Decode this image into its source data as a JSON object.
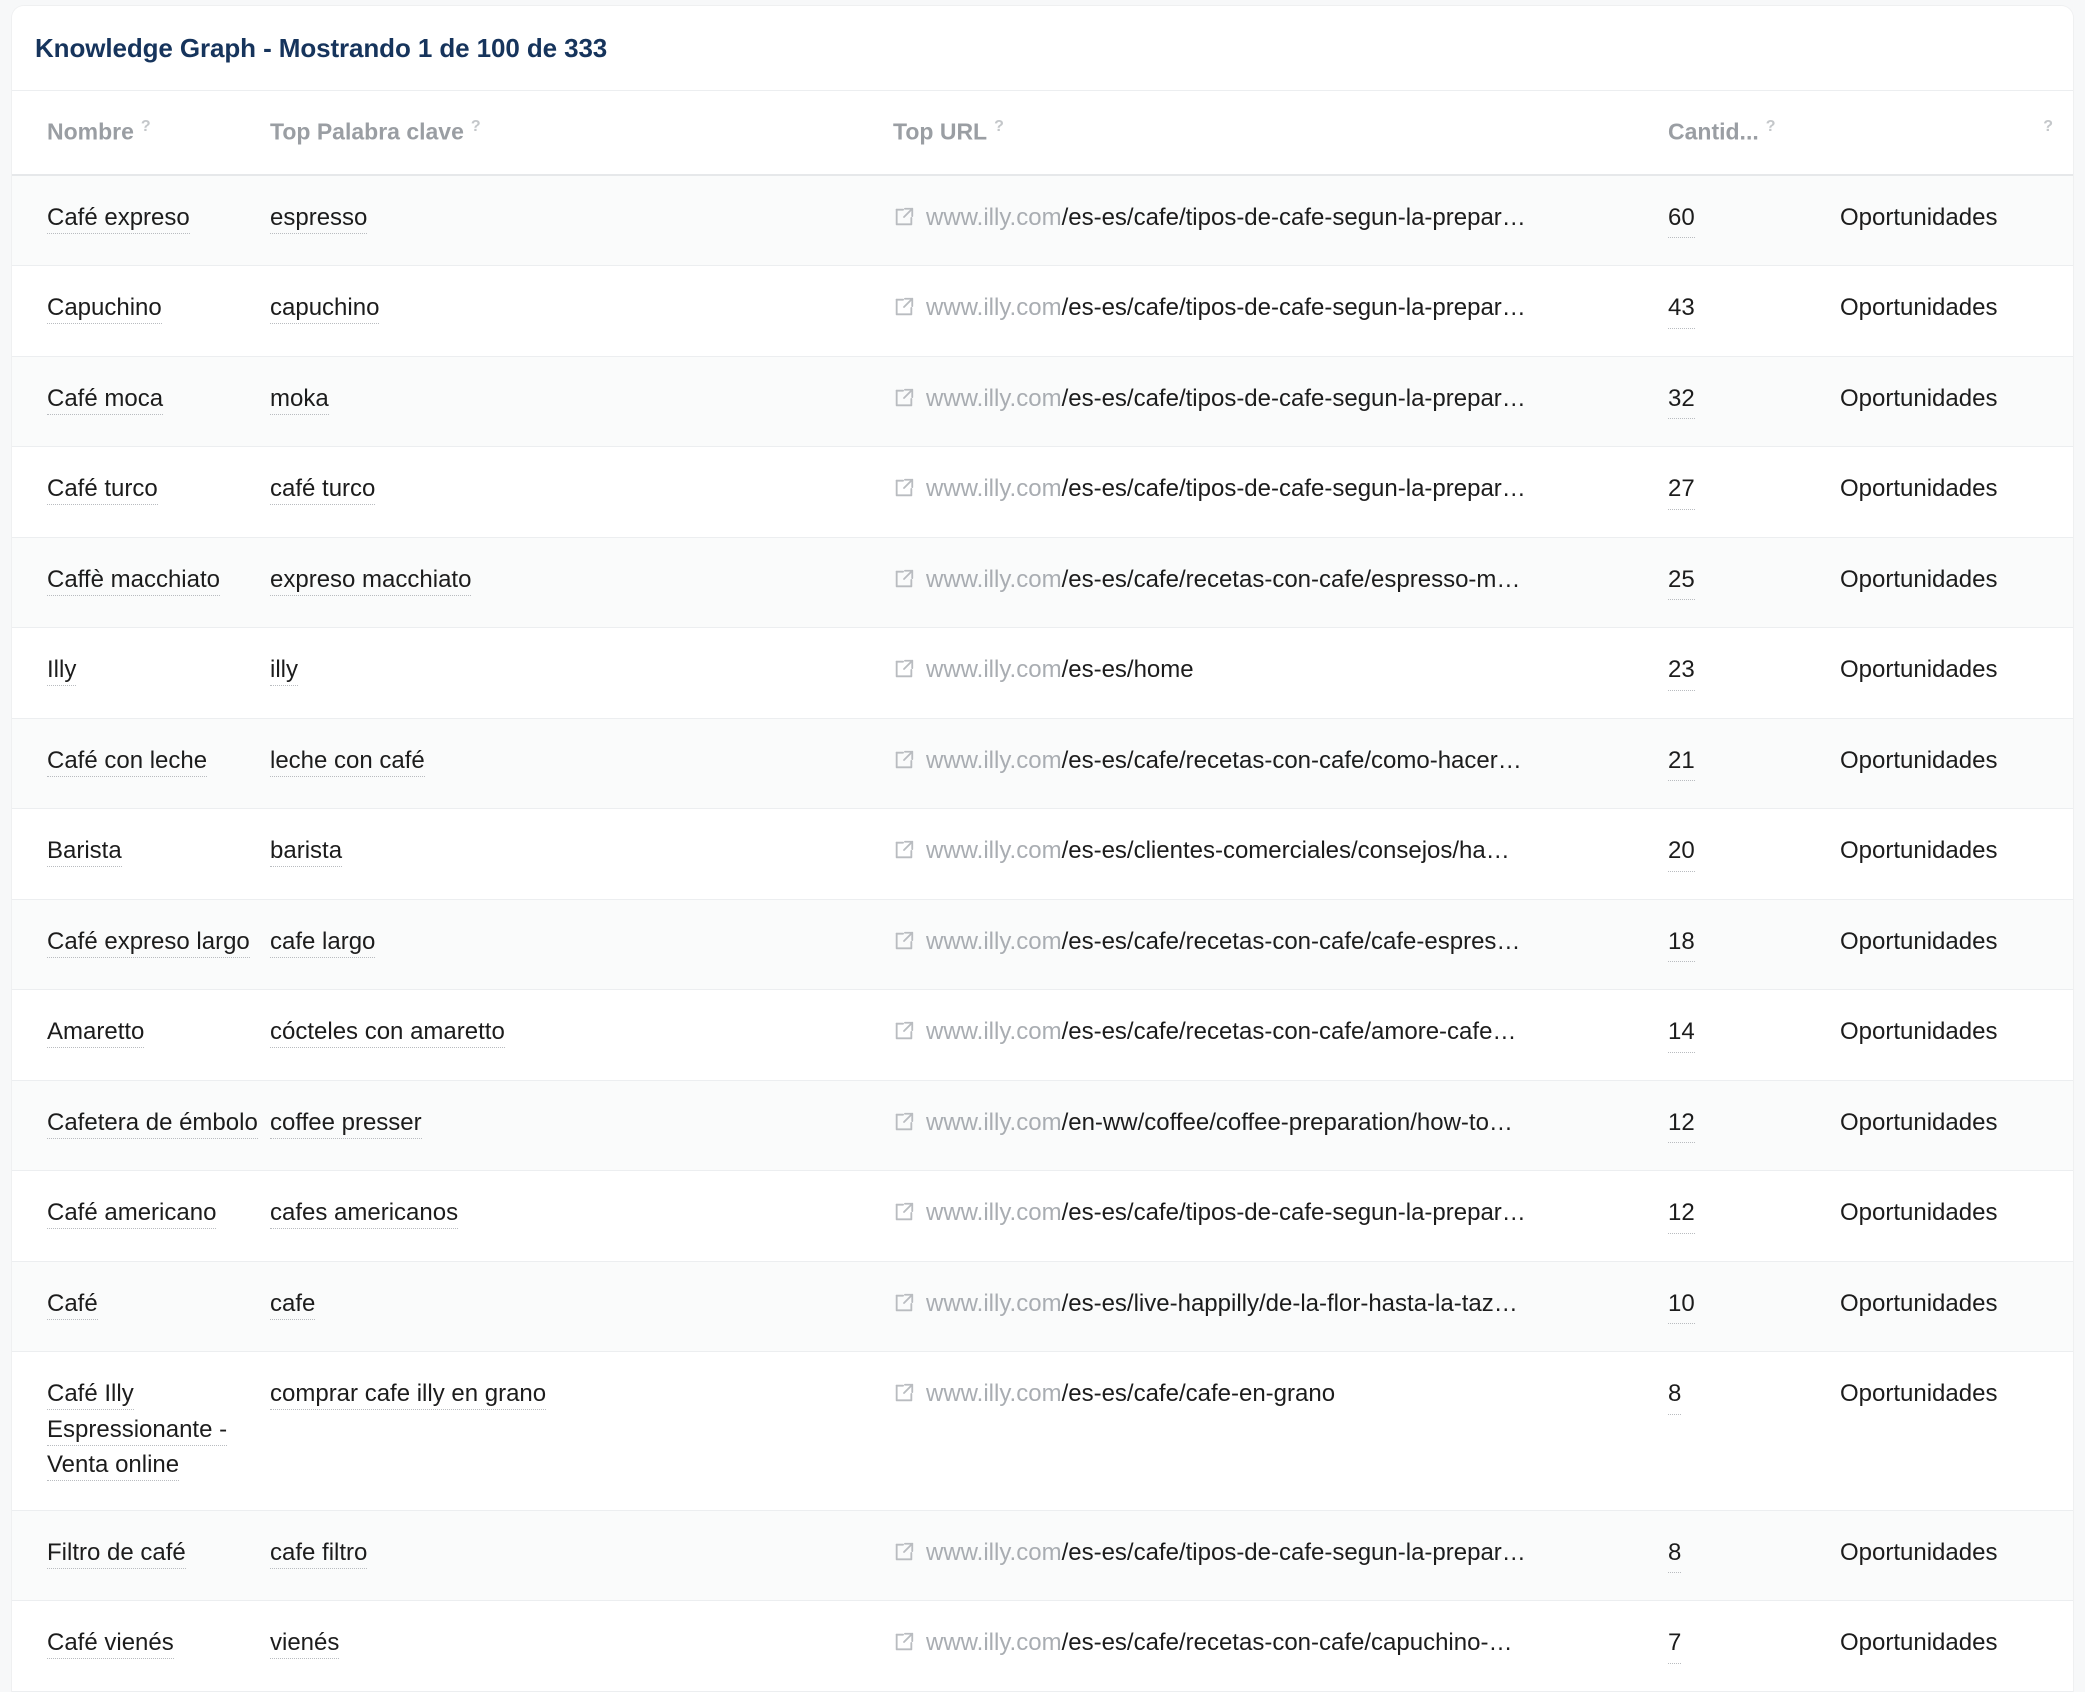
{
  "card": {
    "title": "Knowledge Graph - Mostrando 1 de 100 de 333"
  },
  "table": {
    "headers": [
      {
        "label": "Nombre",
        "help": "?"
      },
      {
        "label": "Top Palabra clave",
        "help": "?"
      },
      {
        "label": "Top URL",
        "help": "?"
      },
      {
        "label": "Cantid...",
        "help": "?"
      },
      {
        "label": "",
        "help": "?"
      }
    ],
    "rows": [
      {
        "name": "Café expreso",
        "keyword": "espresso",
        "url_domain": "www.illy.com",
        "url_path": "/es-es/cafe/tipos-de-cafe-segun-la-prepar…",
        "quantity": "60",
        "action": "Oportunidades"
      },
      {
        "name": "Capuchino",
        "keyword": "capuchino",
        "url_domain": "www.illy.com",
        "url_path": "/es-es/cafe/tipos-de-cafe-segun-la-prepar…",
        "quantity": "43",
        "action": "Oportunidades"
      },
      {
        "name": "Café moca",
        "keyword": "moka",
        "url_domain": "www.illy.com",
        "url_path": "/es-es/cafe/tipos-de-cafe-segun-la-prepar…",
        "quantity": "32",
        "action": "Oportunidades"
      },
      {
        "name": "Café turco",
        "keyword": "café turco",
        "url_domain": "www.illy.com",
        "url_path": "/es-es/cafe/tipos-de-cafe-segun-la-prepar…",
        "quantity": "27",
        "action": "Oportunidades"
      },
      {
        "name": "Caffè macchiato",
        "keyword": "expreso macchiato",
        "url_domain": "www.illy.com",
        "url_path": "/es-es/cafe/recetas-con-cafe/espresso-m…",
        "quantity": "25",
        "action": "Oportunidades"
      },
      {
        "name": "Illy",
        "keyword": "illy",
        "url_domain": "www.illy.com",
        "url_path": "/es-es/home",
        "quantity": "23",
        "action": "Oportunidades"
      },
      {
        "name": "Café con leche",
        "keyword": "leche con café",
        "url_domain": "www.illy.com",
        "url_path": "/es-es/cafe/recetas-con-cafe/como-hacer…",
        "quantity": "21",
        "action": "Oportunidades"
      },
      {
        "name": "Barista",
        "keyword": "barista",
        "url_domain": "www.illy.com",
        "url_path": "/es-es/clientes-comerciales/consejos/ha…",
        "quantity": "20",
        "action": "Oportunidades"
      },
      {
        "name": "Café expreso largo",
        "keyword": "cafe largo",
        "url_domain": "www.illy.com",
        "url_path": "/es-es/cafe/recetas-con-cafe/cafe-espres…",
        "quantity": "18",
        "action": "Oportunidades"
      },
      {
        "name": "Amaretto",
        "keyword": "cócteles con amaretto",
        "url_domain": "www.illy.com",
        "url_path": "/es-es/cafe/recetas-con-cafe/amore-cafe…",
        "quantity": "14",
        "action": "Oportunidades"
      },
      {
        "name": "Cafetera de émbolo",
        "keyword": "coffee presser",
        "url_domain": "www.illy.com",
        "url_path": "/en-ww/coffee/coffee-preparation/how-to…",
        "quantity": "12",
        "action": "Oportunidades"
      },
      {
        "name": "Café americano",
        "keyword": "cafes americanos",
        "url_domain": "www.illy.com",
        "url_path": "/es-es/cafe/tipos-de-cafe-segun-la-prepar…",
        "quantity": "12",
        "action": "Oportunidades"
      },
      {
        "name": "Café",
        "keyword": "cafe",
        "url_domain": "www.illy.com",
        "url_path": "/es-es/live-happilly/de-la-flor-hasta-la-taz…",
        "quantity": "10",
        "action": "Oportunidades"
      },
      {
        "name": "Café Illy Espressionante - Venta online",
        "keyword": "comprar cafe illy en grano",
        "url_domain": "www.illy.com",
        "url_path": "/es-es/cafe/cafe-en-grano",
        "quantity": "8",
        "action": "Oportunidades"
      },
      {
        "name": "Filtro de café",
        "keyword": "cafe filtro",
        "url_domain": "www.illy.com",
        "url_path": "/es-es/cafe/tipos-de-cafe-segun-la-prepar…",
        "quantity": "8",
        "action": "Oportunidades"
      },
      {
        "name": "Café vienés",
        "keyword": "vienés",
        "url_domain": "www.illy.com",
        "url_path": "/es-es/cafe/recetas-con-cafe/capuchino-…",
        "quantity": "7",
        "action": "Oportunidades"
      }
    ]
  },
  "icons": {
    "external_link": "external-link-icon"
  },
  "colors": {
    "title": "#16345c",
    "header_text": "#9a9ea3",
    "row_alt": "#fafbfb",
    "url_domain": "#a9adb2",
    "text": "#1c1c1c"
  }
}
